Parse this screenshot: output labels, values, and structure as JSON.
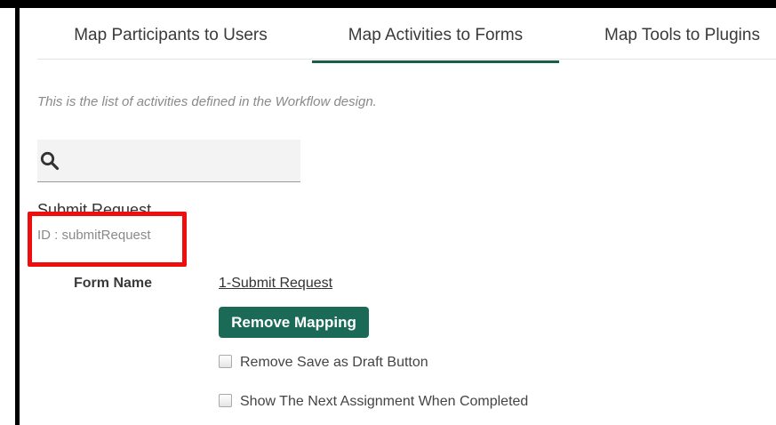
{
  "tabs": [
    {
      "label": "Map Participants to Users",
      "active": false
    },
    {
      "label": "Map Activities to Forms",
      "active": true
    },
    {
      "label": "Map Tools to Plugins",
      "active": false
    }
  ],
  "intro_text": "This is the list of activities defined in the Workflow design.",
  "search": {
    "value": "",
    "icon": "search-icon"
  },
  "activity": {
    "title": "Submit Request",
    "id_text": "ID : submitRequest"
  },
  "form": {
    "label": "Form Name",
    "value": "1-Submit Request",
    "remove_button": "Remove Mapping"
  },
  "options": [
    {
      "label": "Remove Save as Draft Button",
      "checked": false
    },
    {
      "label": "Show The Next Assignment When Completed",
      "checked": false
    }
  ],
  "colors": {
    "accent": "#1a6a57",
    "tab_underline": "#1a5e4a",
    "highlight": "#ef0e0e"
  }
}
